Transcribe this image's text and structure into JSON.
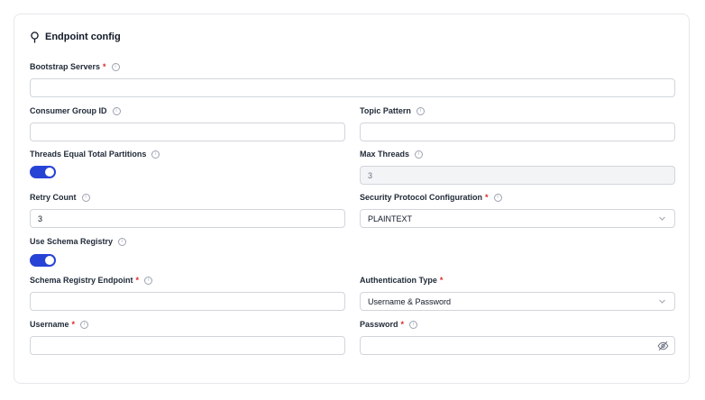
{
  "card": {
    "title": "Endpoint config"
  },
  "fields": {
    "bootstrap_servers": {
      "label": "Bootstrap Servers",
      "required": "*",
      "value": ""
    },
    "consumer_group_id": {
      "label": "Consumer Group ID",
      "value": ""
    },
    "topic_pattern": {
      "label": "Topic Pattern",
      "value": ""
    },
    "threads_equal_total_partitions": {
      "label": "Threads Equal Total Partitions",
      "enabled": true
    },
    "max_threads": {
      "label": "Max Threads",
      "value": "3",
      "disabled": true
    },
    "retry_count": {
      "label": "Retry Count",
      "value": "3"
    },
    "security_protocol": {
      "label": "Security Protocol Configuration",
      "required": "*",
      "selected": "PLAINTEXT"
    },
    "use_schema_registry": {
      "label": "Use Schema Registry",
      "enabled": true
    },
    "schema_registry_endpoint": {
      "label": "Schema Registry Endpoint",
      "required": "*",
      "value": ""
    },
    "authentication_type": {
      "label": "Authentication Type",
      "required": "*",
      "selected": "Username & Password"
    },
    "username": {
      "label": "Username",
      "required": "*",
      "value": ""
    },
    "password": {
      "label": "Password",
      "required": "*",
      "value": ""
    }
  },
  "info_glyph": "i",
  "colors": {
    "accent": "#2743d6",
    "required": "#dc2626",
    "border": "#d1d5db",
    "disabled_bg": "#f3f4f6"
  },
  "icons": {
    "title": "lightbulb-icon",
    "info": "info-icon",
    "select": "chevron-down-icon",
    "password": "eye-off-icon"
  }
}
